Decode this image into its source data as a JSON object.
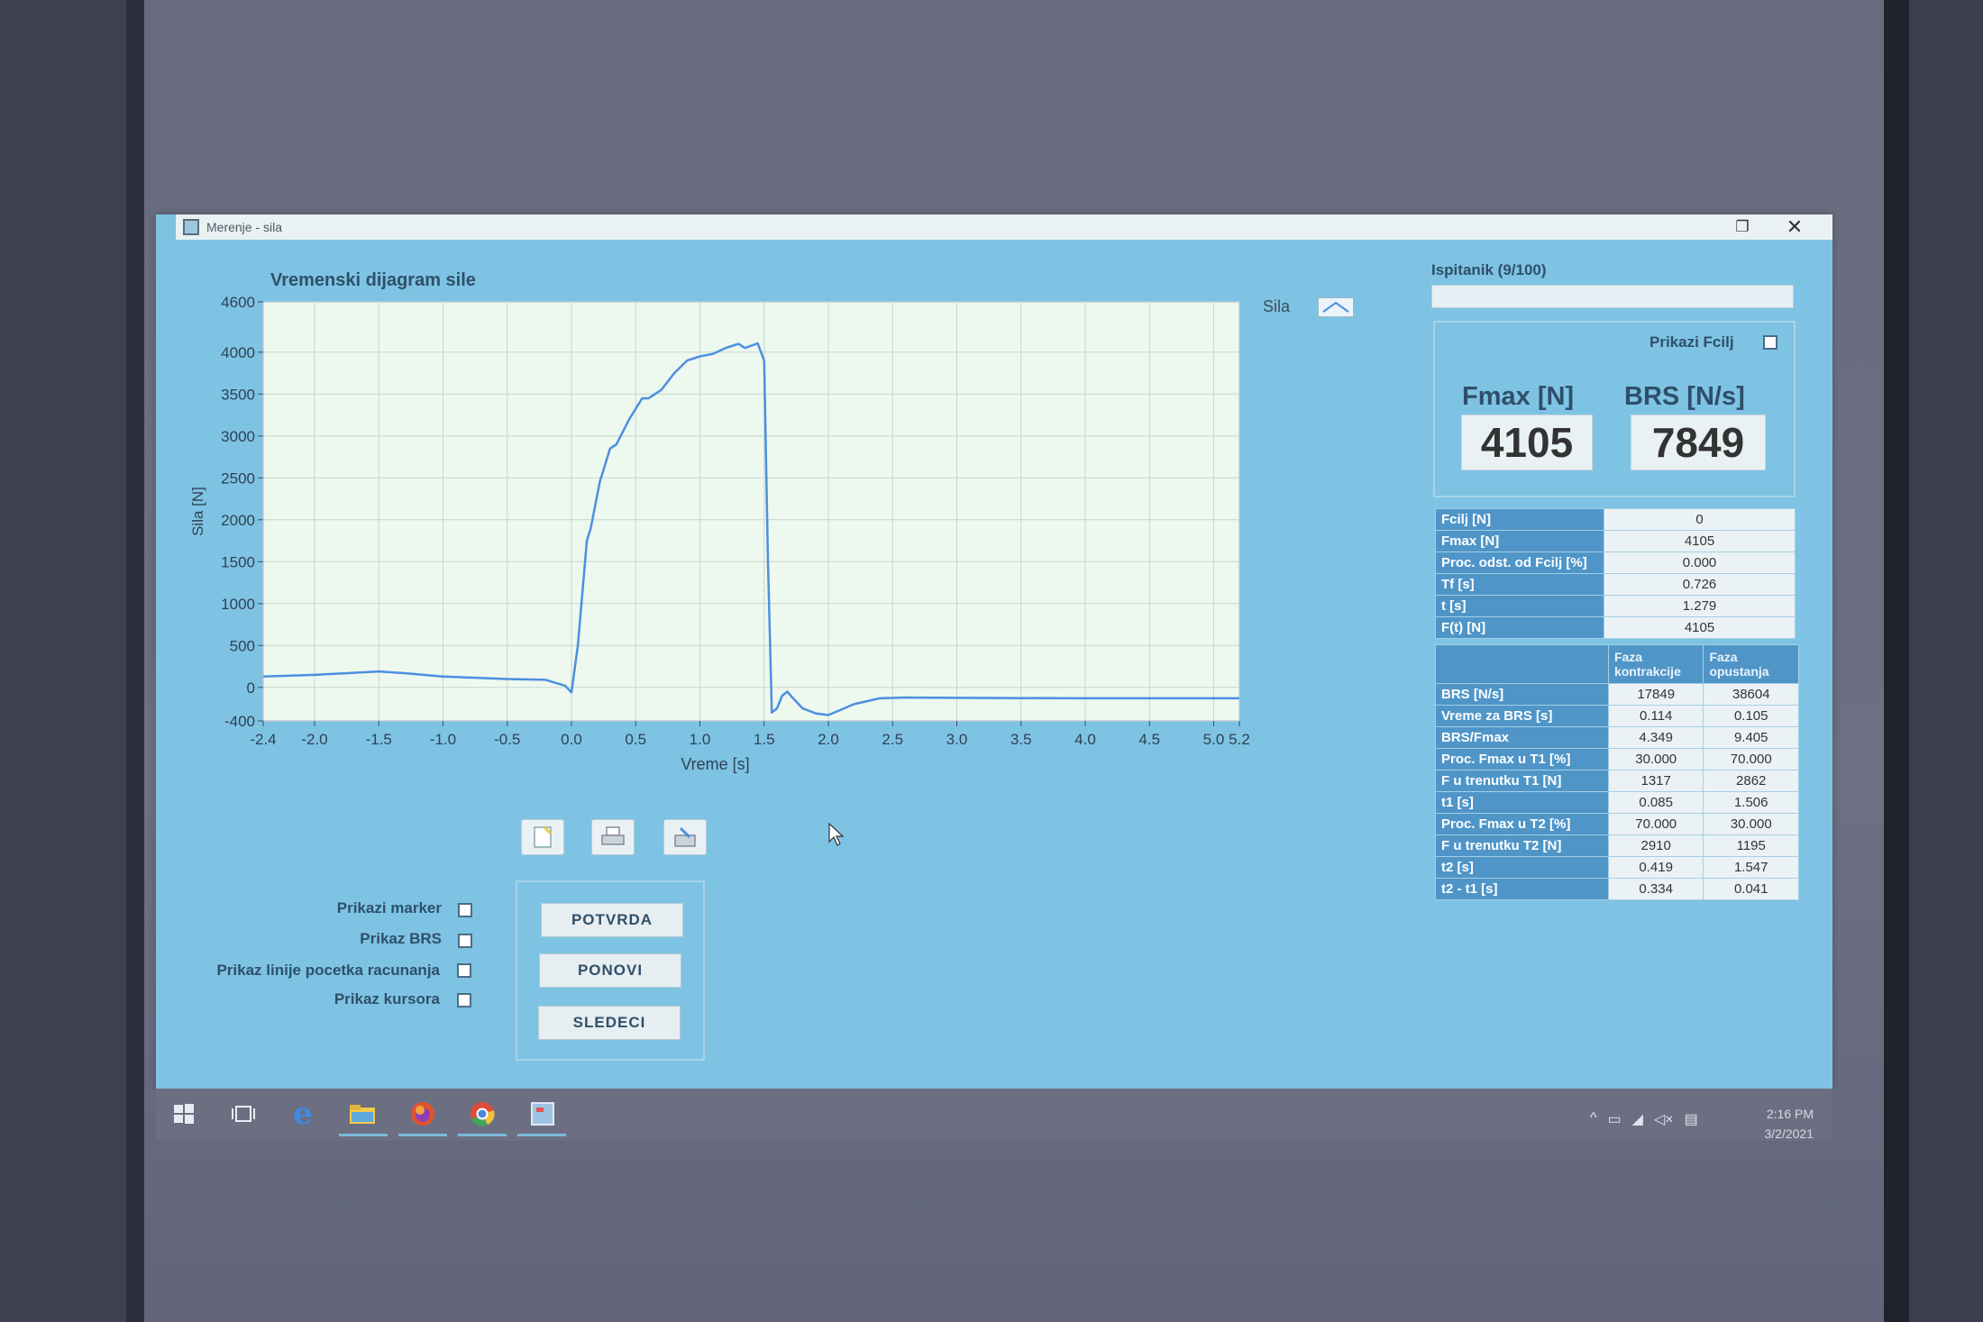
{
  "window": {
    "title": "Merenje - sila"
  },
  "chart": {
    "title": "Vremenski dijagram sile",
    "legend_label": "Sila"
  },
  "chart_data": {
    "type": "line",
    "xlabel": "Vreme [s]",
    "ylabel": "Sila [N]",
    "xlim": [
      -2.4,
      5.2
    ],
    "ylim": [
      -400,
      4600
    ],
    "xticks": [
      "-2.4",
      "-2.0",
      "-1.5",
      "-1.0",
      "-0.5",
      "0.0",
      "0.5",
      "1.0",
      "1.5",
      "2.0",
      "2.5",
      "3.0",
      "3.5",
      "4.0",
      "4.5",
      "5.0",
      "5.2"
    ],
    "yticks": [
      "4600",
      "4000",
      "3500",
      "3000",
      "2500",
      "2000",
      "1500",
      "1000",
      "500",
      "0",
      "-400"
    ],
    "series": [
      {
        "name": "Sila",
        "x": [
          -2.4,
          -2.0,
          -1.5,
          -1.3,
          -1.0,
          -0.5,
          -0.2,
          -0.05,
          0.0,
          0.05,
          0.12,
          0.15,
          0.22,
          0.3,
          0.35,
          0.45,
          0.55,
          0.6,
          0.7,
          0.8,
          0.9,
          1.0,
          1.1,
          1.2,
          1.3,
          1.35,
          1.45,
          1.5,
          1.53,
          1.56,
          1.6,
          1.64,
          1.68,
          1.72,
          1.8,
          1.9,
          2.0,
          2.2,
          2.4,
          2.6,
          3.0,
          4.0,
          5.2
        ],
        "y": [
          130,
          150,
          190,
          170,
          130,
          100,
          90,
          20,
          -60,
          500,
          1750,
          1900,
          2450,
          2850,
          2900,
          3200,
          3450,
          3450,
          3550,
          3750,
          3900,
          3950,
          3980,
          4050,
          4100,
          4050,
          4105,
          3900,
          1500,
          -300,
          -250,
          -100,
          -50,
          -120,
          -250,
          -310,
          -330,
          -200,
          -130,
          -120,
          -125,
          -130,
          -130
        ]
      }
    ],
    "grid": true,
    "legend": "top-right"
  },
  "ispitanik": {
    "label": "Ispitanik (9/100)"
  },
  "prikazi_fcilj": {
    "label": "Prikazi Fcilj"
  },
  "fmax": {
    "label": "Fmax [N]",
    "value": "4105"
  },
  "brs": {
    "label": "BRS [N/s]",
    "value": "7849"
  },
  "summary_table": [
    {
      "label": "Fcilj [N]",
      "value": "0"
    },
    {
      "label": "Fmax [N]",
      "value": "4105"
    },
    {
      "label": "Proc. odst. od Fcilj [%]",
      "value": "0.000"
    },
    {
      "label": "Tf [s]",
      "value": "0.726"
    },
    {
      "label": "t [s]",
      "value": "1.279"
    },
    {
      "label": "F(t) [N]",
      "value": "4105"
    }
  ],
  "phase_table": {
    "col1": "Faza kontrakcije",
    "col2": "Faza opustanja",
    "rows": [
      {
        "label": "BRS [N/s]",
        "c1": "17849",
        "c2": "38604"
      },
      {
        "label": "Vreme za BRS [s]",
        "c1": "0.114",
        "c2": "0.105"
      },
      {
        "label": "BRS/Fmax",
        "c1": "4.349",
        "c2": "9.405"
      },
      {
        "label": "Proc. Fmax u T1 [%]",
        "c1": "30.000",
        "c2": "70.000"
      },
      {
        "label": "F u trenutku T1 [N]",
        "c1": "1317",
        "c2": "2862"
      },
      {
        "label": "t1 [s]",
        "c1": "0.085",
        "c2": "1.506"
      },
      {
        "label": "Proc. Fmax u T2 [%]",
        "c1": "70.000",
        "c2": "30.000"
      },
      {
        "label": "F u trenutku T2 [N]",
        "c1": "2910",
        "c2": "1195"
      },
      {
        "label": "t2 [s]",
        "c1": "0.419",
        "c2": "1.547"
      },
      {
        "label": "t2 - t1 [s]",
        "c1": "0.334",
        "c2": "0.041"
      }
    ]
  },
  "options": [
    {
      "label": "Prikazi marker"
    },
    {
      "label": "Prikaz BRS"
    },
    {
      "label": "Prikaz linije pocetka racunanja"
    },
    {
      "label": "Prikaz kursora"
    }
  ],
  "buttons": {
    "confirm": "POTVRDA",
    "repeat": "PONOVI",
    "next": "SLEDECI"
  },
  "taskbar": {
    "time": "2:16 PM",
    "date": "3/2/2021"
  },
  "colors": {
    "window_bg": "#7ec3e3",
    "table_header": "#4f95c8",
    "series_line": "#4d8fe0",
    "plot_bg": "#edf8ef"
  }
}
